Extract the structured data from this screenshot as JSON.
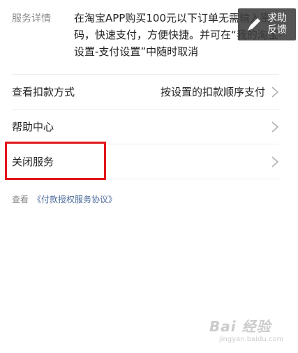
{
  "service_detail": {
    "label": "服务详情",
    "text": "在淘宝APP购买100元以下订单无需输入密码，快速支付，方便快捷。并可在“我的淘宝-设置-支付设置”中随时取消"
  },
  "rows": [
    {
      "label": "查看扣款方式",
      "value": "按设置的扣款顺序支付"
    },
    {
      "label": "帮助中心",
      "value": ""
    },
    {
      "label": "关闭服务",
      "value": ""
    }
  ],
  "agreement": {
    "prefix": "查看",
    "link": "《付款授权服务协议》"
  },
  "feedback": {
    "line1": "求助",
    "line2": "反馈"
  },
  "watermark": {
    "brand": "Bai 经验",
    "url": "jingyan.baidu.com"
  },
  "colors": {
    "highlight_box": "#e2161b",
    "link": "#4a6a9a"
  }
}
